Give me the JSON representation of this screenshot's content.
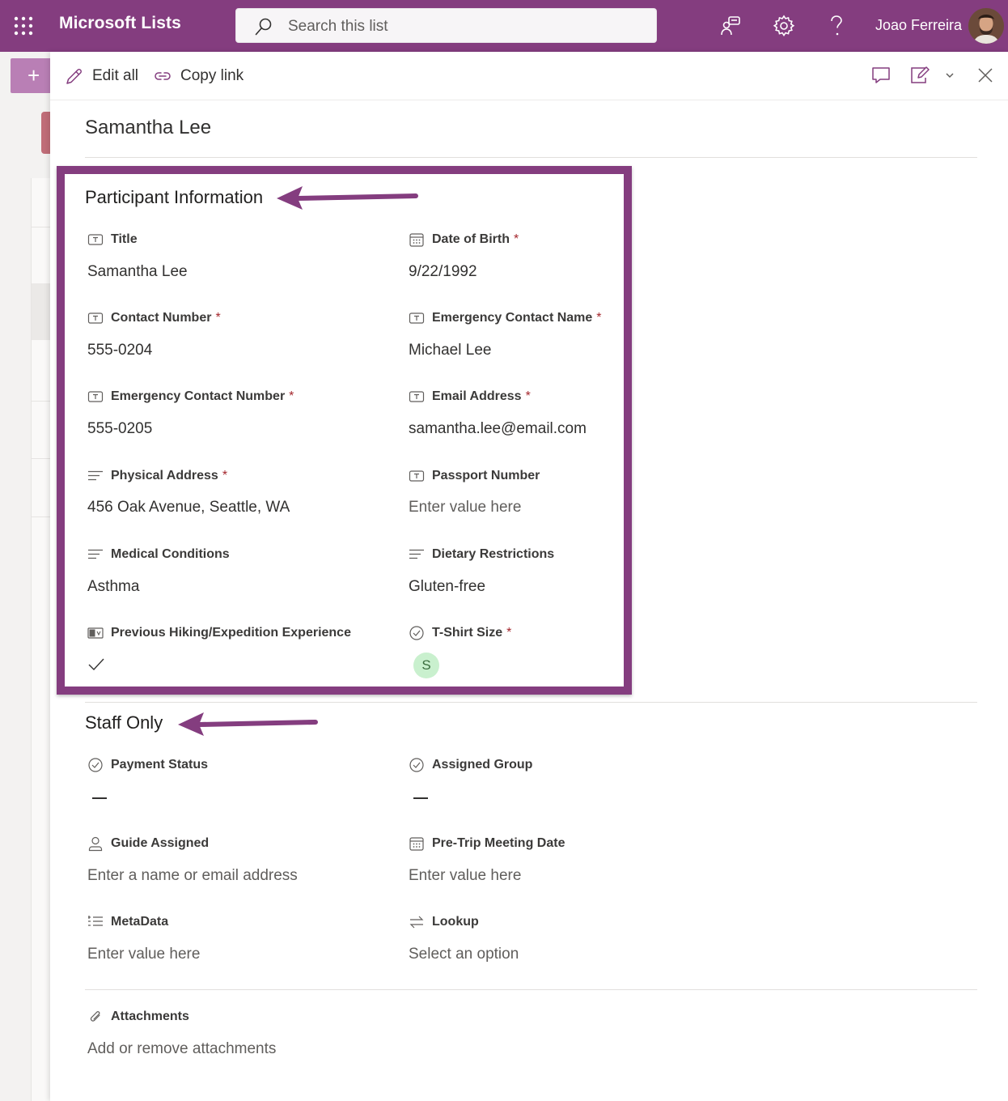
{
  "header": {
    "app_name": "Microsoft Lists",
    "search_placeholder": "Search this list",
    "user_name": "Joao Ferreira",
    "brand_color": "#843d7f"
  },
  "commands": {
    "edit_all": "Edit all",
    "copy_link": "Copy link"
  },
  "item": {
    "title": "Samantha Lee"
  },
  "participant": {
    "section_title": "Participant Information",
    "fields": {
      "title": {
        "label": "Title",
        "value": "Samantha Lee",
        "icon": "text-field-icon"
      },
      "dob": {
        "label": "Date of Birth",
        "value": "9/22/1992",
        "icon": "calendar-icon",
        "required": "*"
      },
      "contact_number": {
        "label": "Contact Number",
        "value": "555-0204",
        "icon": "text-field-icon",
        "required": "*"
      },
      "emergency_name": {
        "label": "Emergency Contact Name",
        "value": "Michael Lee",
        "icon": "text-field-icon",
        "required": "*"
      },
      "emergency_number": {
        "label": "Emergency Contact Number",
        "value": "555-0205",
        "icon": "text-field-icon",
        "required": "*"
      },
      "email": {
        "label": "Email Address",
        "value": "samantha.lee@email.com",
        "icon": "text-field-icon",
        "required": "*"
      },
      "address": {
        "label": "Physical Address",
        "value": "456 Oak Avenue, Seattle, WA",
        "icon": "multiline-icon",
        "required": "*"
      },
      "passport": {
        "label": "Passport Number",
        "placeholder": "Enter value here",
        "icon": "text-field-icon"
      },
      "medical": {
        "label": "Medical Conditions",
        "value": "Asthma",
        "icon": "multiline-icon"
      },
      "dietary": {
        "label": "Dietary Restrictions",
        "value": "Gluten-free",
        "icon": "multiline-icon"
      },
      "experience": {
        "label": "Previous Hiking/Expedition Experience",
        "icon": "yes-no-icon",
        "value_icon": "checkmark-icon"
      },
      "tshirt": {
        "label": "T-Shirt Size",
        "value": "S",
        "icon": "choice-icon",
        "required": "*",
        "badge_color": "#c9f0ce"
      }
    }
  },
  "staff": {
    "section_title": "Staff Only",
    "fields": {
      "payment": {
        "label": "Payment Status",
        "icon": "choice-icon"
      },
      "group": {
        "label": "Assigned Group",
        "icon": "choice-icon"
      },
      "guide": {
        "label": "Guide Assigned",
        "placeholder": "Enter a name or email address",
        "icon": "person-icon"
      },
      "meeting": {
        "label": "Pre-Trip Meeting Date",
        "placeholder": "Enter value here",
        "icon": "calendar-icon"
      },
      "metadata": {
        "label": "MetaData",
        "placeholder": "Enter value here",
        "icon": "metadata-icon"
      },
      "lookup": {
        "label": "Lookup",
        "placeholder": "Select an option",
        "icon": "lookup-icon"
      }
    }
  },
  "attachments": {
    "label": "Attachments",
    "placeholder": "Add or remove attachments",
    "icon": "paperclip-icon"
  }
}
